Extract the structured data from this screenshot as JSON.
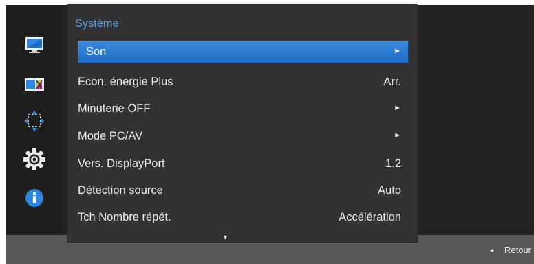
{
  "menu": {
    "title": "Système",
    "items": [
      {
        "label": "Son",
        "value": "",
        "arrow": "►",
        "selected": true
      },
      {
        "label": "Econ. énergie Plus",
        "value": "Arr.",
        "arrow": ""
      },
      {
        "label": "Minuterie OFF",
        "value": "",
        "arrow": "►"
      },
      {
        "label": "Mode PC/AV",
        "value": "",
        "arrow": "►"
      },
      {
        "label": "Vers. DisplayPort",
        "value": "1.2",
        "arrow": ""
      },
      {
        "label": "Détection source",
        "value": "Auto",
        "arrow": ""
      },
      {
        "label": "Tch Nombre répét.",
        "value": "Accélération",
        "arrow": ""
      }
    ],
    "scroll_indicator": "▼"
  },
  "sidebar": {
    "icons": [
      {
        "name": "picture-icon"
      },
      {
        "name": "color-icon"
      },
      {
        "name": "position-icon"
      },
      {
        "name": "settings-gear-icon"
      },
      {
        "name": "info-icon"
      }
    ]
  },
  "footer": {
    "back_arrow": "◄",
    "back_label": "Retour"
  },
  "colors": {
    "accent": "#3f8ce0",
    "title": "#5aa2ea",
    "panel": "#323232",
    "background": "#232323",
    "bottom_bar": "#585858"
  }
}
